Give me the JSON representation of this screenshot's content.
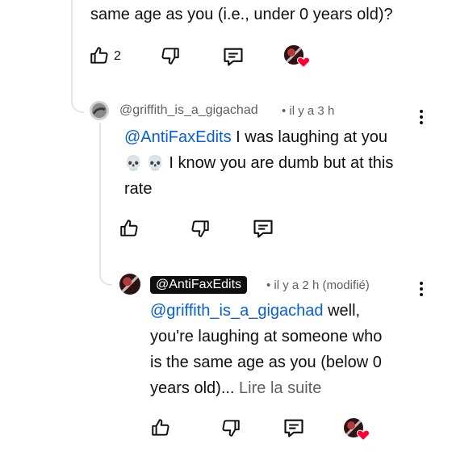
{
  "top_comment": {
    "text_tail": "same age as you (i.e., under 0 years old)?",
    "like_count": "2"
  },
  "reply1": {
    "author": "@griffith_is_a_gigachad",
    "time": "• il y a 3 h",
    "mention": "@AntiFaxEdits",
    "text_line1": " I was laughing at you",
    "emoji": "💀 💀",
    "text_line2": " I know you are dumb but at this",
    "text_line3": "rate"
  },
  "reply2": {
    "author": "@AntiFaxEdits",
    "time": "• il y a 2 h (modifié)",
    "mention": "@griffith_is_a_gigachad",
    "text_line1": " well,",
    "text_line2": "you're laughing at someone who",
    "text_line3": "is the same age as you (below 0",
    "text_line4": "years old)...",
    "read_more": "Lire la suite"
  },
  "icons": {
    "like": "thumbs-up-icon",
    "dislike": "thumbs-down-icon",
    "reply": "reply-icon",
    "creator_heart": "creator-heart-badge",
    "more": "more-vert-icon"
  },
  "colors": {
    "mention": "#065fd4",
    "meta": "#606060",
    "heart": "#ff0033",
    "creator_pill": "#0f0f0f"
  }
}
